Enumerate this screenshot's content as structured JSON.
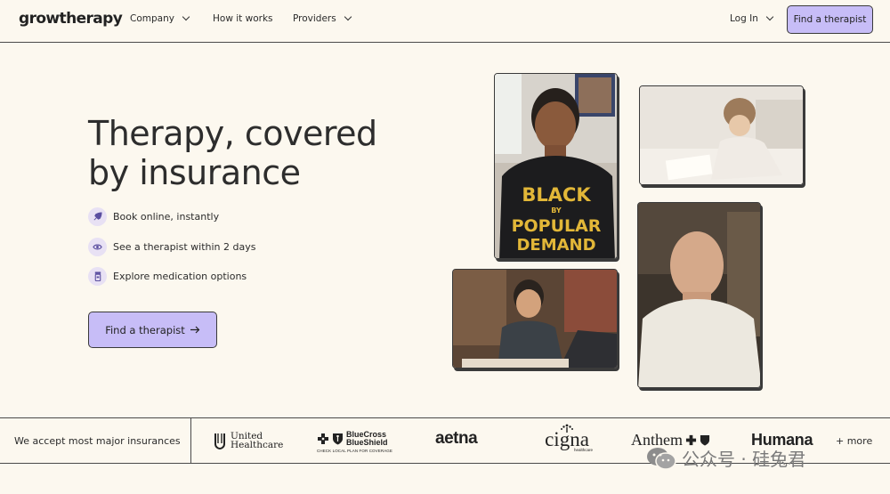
{
  "nav": {
    "logo": "growtherapy",
    "company": "Company",
    "how_it_works": "How it works",
    "providers": "Providers",
    "login": "Log In",
    "cta": "Find a therapist"
  },
  "hero": {
    "title_line1": "Therapy, covered",
    "title_line2": "by insurance",
    "features": [
      {
        "label": "Book online, instantly",
        "icon": "rocket-icon"
      },
      {
        "label": "See a therapist within 2 days",
        "icon": "eye-icon"
      },
      {
        "label": "Explore medication options",
        "icon": "pill-bottle-icon"
      }
    ],
    "cta": "Find a therapist"
  },
  "photos": {
    "shirt_text": [
      "BLACK",
      "BY",
      "POPULAR",
      "DEMAND"
    ]
  },
  "insurance": {
    "label": "We accept most major insurances",
    "brands": {
      "uhc_line1": "United",
      "uhc_line2": "Healthcare",
      "bcbs_line1": "BlueCross",
      "bcbs_line2": "BlueShield",
      "bcbs_sub": "CHECK LOCAL PLAN FOR COVERAGE",
      "aetna": "aetna",
      "cigna": "cigna",
      "cigna_sub": "healthcare",
      "anthem": "Anthem",
      "humana": "Humana"
    },
    "more": "+ more"
  },
  "watermark": "公众号 · 硅兔君",
  "colors": {
    "background": "#fcf8ef",
    "accent": "#c7bdf7",
    "text": "#2b2b2b"
  }
}
